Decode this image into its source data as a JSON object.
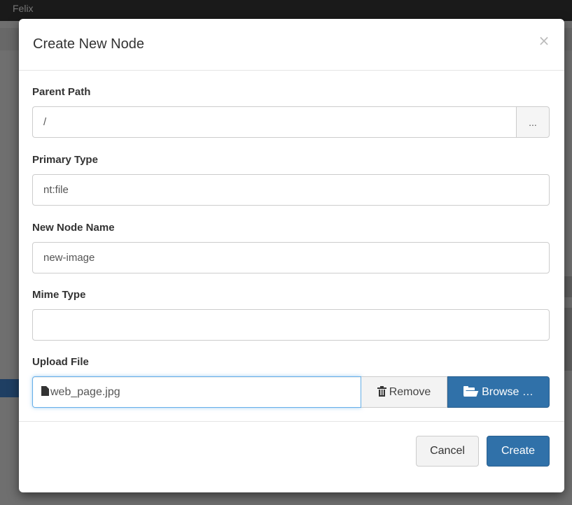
{
  "app": {
    "title": "Felix"
  },
  "modal": {
    "title": "Create New Node",
    "close_label": "×"
  },
  "fields": {
    "parent_path": {
      "label": "Parent Path",
      "value": "/",
      "button_label": "..."
    },
    "primary_type": {
      "label": "Primary Type",
      "value": "nt:file"
    },
    "node_name": {
      "label": "New Node Name",
      "value": "new-image"
    },
    "mime_type": {
      "label": "Mime Type",
      "value": ""
    },
    "upload_file": {
      "label": "Upload File",
      "filename": "web_page.jpg",
      "remove_label": "Remove",
      "browse_label": "Browse …"
    }
  },
  "footer": {
    "cancel_label": "Cancel",
    "create_label": "Create"
  },
  "icons": {
    "close": "close-icon",
    "file": "file-icon",
    "trash": "trash-icon",
    "folder": "folder-open-icon"
  },
  "colors": {
    "primary": "#3071a9",
    "focus_border": "#66afe9",
    "backdrop": "#6f6f6f"
  }
}
